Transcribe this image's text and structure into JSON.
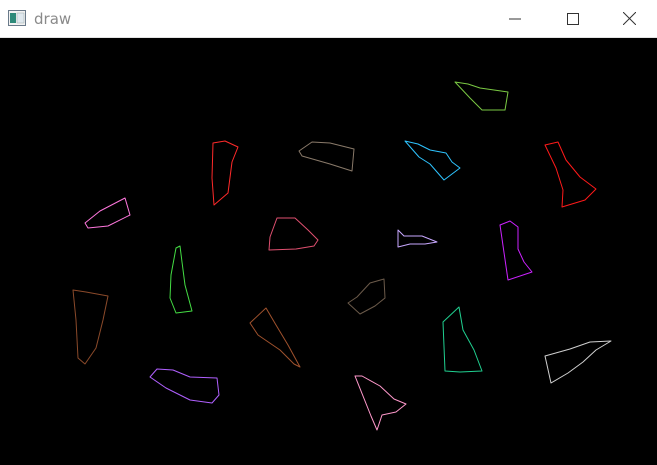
{
  "window": {
    "title": "draw",
    "controls": {
      "minimize_icon": "minimize-icon",
      "maximize_icon": "maximize-icon",
      "close_icon": "close-icon"
    }
  },
  "canvas": {
    "background": "#000000",
    "shape_colors": [
      "#7ac943",
      "#ff2a2a",
      "#8a7a6a",
      "#2ec4ff",
      "#ff1a1a",
      "#ff77dd",
      "#e05070",
      "#c8a8ff",
      "#cc22ff",
      "#44dd44",
      "#8b4a2a",
      "#6b5a4a",
      "#a0522d",
      "#20d090",
      "#d0d0d0",
      "#b060ff",
      "#ff99cc"
    ]
  }
}
